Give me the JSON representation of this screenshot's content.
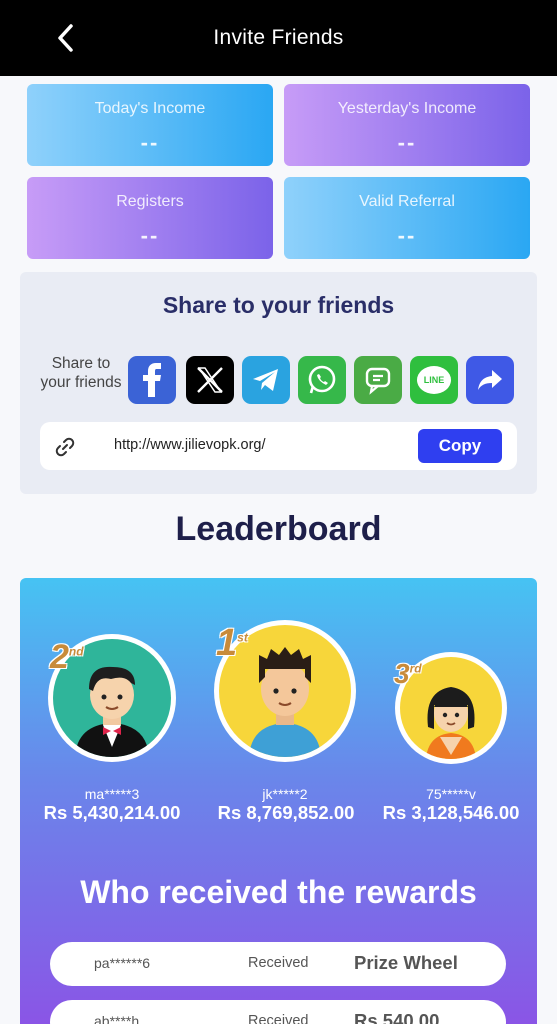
{
  "header": {
    "title": "Invite Friends"
  },
  "stats": {
    "today": {
      "label": "Today's Income",
      "value": "--"
    },
    "yesterday": {
      "label": "Yesterday's Income",
      "value": "--"
    },
    "registers": {
      "label": "Registers",
      "value": "--"
    },
    "valid": {
      "label": "Valid Referral",
      "value": "--"
    }
  },
  "share": {
    "heading": "Share to your friends",
    "side_label": "Share to your friends",
    "icons": [
      "facebook-icon",
      "x-icon",
      "telegram-icon",
      "whatsapp-icon",
      "message-icon",
      "line-icon",
      "share-arrow-icon"
    ],
    "line_text": "LINE",
    "url": "http://www.jilievopk.org/",
    "copy_label": "Copy"
  },
  "leaderboard": {
    "title": "Leaderboard",
    "first": {
      "rank": "1",
      "suffix": "st",
      "name": "jk*****2",
      "amount": "Rs  8,769,852.00"
    },
    "second": {
      "rank": "2",
      "suffix": "nd",
      "name": "ma*****3",
      "amount": "Rs  5,430,214.00"
    },
    "third": {
      "rank": "3",
      "suffix": "rd",
      "name": "75*****v",
      "amount": "Rs  3,128,546.00"
    }
  },
  "rewards": {
    "title": "Who received the rewards",
    "rows": [
      {
        "user": "pa******6",
        "status": "Received",
        "prize": "Prize Wheel"
      },
      {
        "user": "ab****h",
        "status": "Received",
        "prize": "Rs  540.00"
      }
    ]
  },
  "colors": {
    "copy_button": "#2f3ff0",
    "heading": "#2a2e68"
  }
}
